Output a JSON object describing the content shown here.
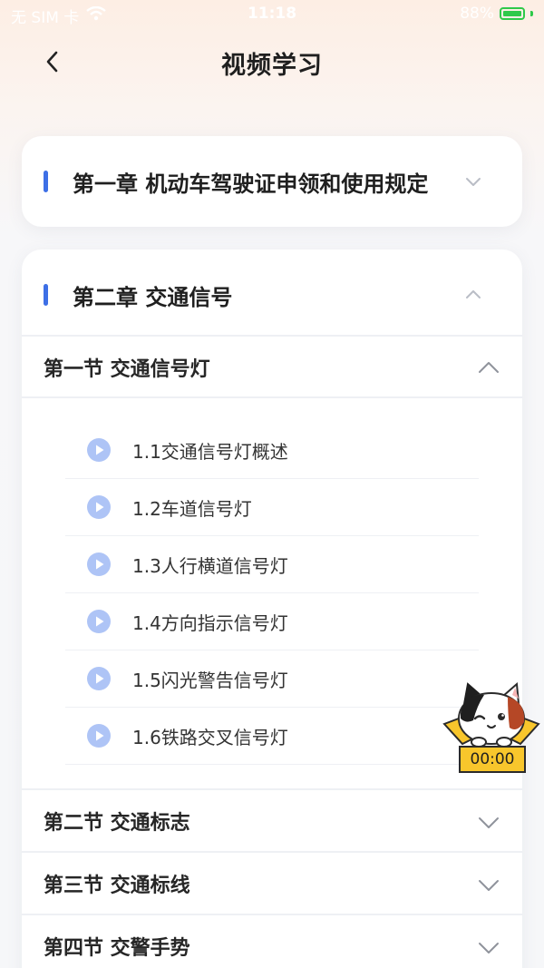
{
  "status_bar": {
    "carrier": "无 SIM 卡",
    "time": "11:18",
    "battery_percent": "88%"
  },
  "nav": {
    "title": "视频学习"
  },
  "chapters": [
    {
      "title": "第一章  机动车驾驶证申领和使用规定",
      "expanded": false
    },
    {
      "title": "第二章  交通信号",
      "expanded": true
    }
  ],
  "sections": [
    {
      "title": "第一节 交通信号灯",
      "expanded": true
    },
    {
      "title": "第二节 交通标志",
      "expanded": false
    },
    {
      "title": "第三节 交通标线",
      "expanded": false
    },
    {
      "title": "第四节 交警手势",
      "expanded": false
    }
  ],
  "lessons": [
    {
      "label": "1.1交通信号灯概述"
    },
    {
      "label": "1.2车道信号灯"
    },
    {
      "label": "1.3人行横道信号灯"
    },
    {
      "label": "1.4方向指示信号灯"
    },
    {
      "label": "1.5闪光警告信号灯"
    },
    {
      "label": "1.6铁路交叉信号灯"
    }
  ],
  "mascot": {
    "timer": "00:00"
  },
  "colors": {
    "accent": "#3d6fe6",
    "play_icon": "#aec4f6",
    "timer_bg": "#f8c62c"
  }
}
